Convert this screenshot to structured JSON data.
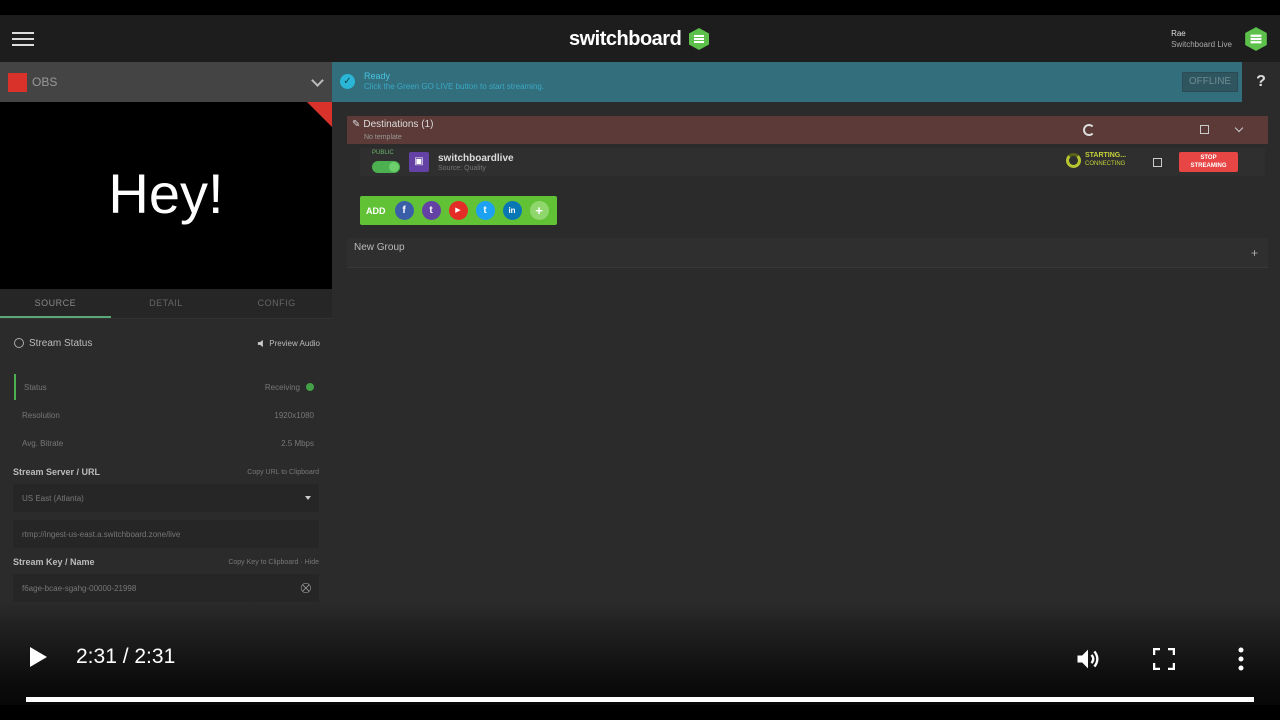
{
  "header": {
    "logo_text": "switchboard",
    "user_name": "Rae",
    "user_org": "Switchboard Live"
  },
  "source": {
    "selected": "OBS",
    "preview_text": "Hey!",
    "tabs": [
      {
        "label": "SOURCE",
        "active": true
      },
      {
        "label": "DETAIL",
        "active": false
      },
      {
        "label": "CONFIG",
        "active": false
      }
    ]
  },
  "stream_status": {
    "title": "Stream Status",
    "preview_audio": "Preview Audio",
    "rows": [
      {
        "label": "Status",
        "value": "Receiving"
      },
      {
        "label": "Resolution",
        "value": "1920x1080"
      },
      {
        "label": "Avg. Bitrate",
        "value": "2.5 Mbps"
      }
    ]
  },
  "stream_server": {
    "label": "Stream Server / URL",
    "hint": "Copy URL to Clipboard",
    "region": "US East (Atlanta)",
    "url": "rtmp://ingest-us-east.a.switchboard.zone/live"
  },
  "stream_key": {
    "label": "Stream Key / Name",
    "hint": "Copy Key to Clipboard · Hide",
    "value": "f6age-bcae-sgahg-00000-21998"
  },
  "ready": {
    "title": "Ready",
    "subtitle": "Click the Green GO LIVE button to start streaming.",
    "offline_label": "OFFLINE",
    "help_label": "?"
  },
  "destinations": {
    "title": "Destinations (1)",
    "subtitle": "No template",
    "row": {
      "visibility": "PUBLIC",
      "name": "switchboardlive",
      "source": "Source: Quality",
      "status": "STARTING...",
      "status_sub": "CONNECTING",
      "stop_label_1": "STOP",
      "stop_label_2": "STREAMING"
    },
    "add_label": "ADD",
    "socials": [
      {
        "icon": "facebook-icon",
        "glyph": "f",
        "color": "#3b5ea8"
      },
      {
        "icon": "twitch-icon",
        "glyph": "t",
        "color": "#6441a5"
      },
      {
        "icon": "youtube-icon",
        "glyph": "▶",
        "color": "#e52d27"
      },
      {
        "icon": "twitter-icon",
        "glyph": "t",
        "color": "#1da1f2"
      },
      {
        "icon": "linkedin-icon",
        "glyph": "in",
        "color": "#0a77b5"
      },
      {
        "icon": "plus-icon",
        "glyph": "+",
        "color": "#8fd66c"
      }
    ],
    "new_group": "New Group"
  },
  "player": {
    "time": "2:31 / 2:31",
    "progress": 1.0
  },
  "colors": {
    "brand_green": "#62c236",
    "ready_bar": "#336e7c",
    "destinations_header": "#5b3a37",
    "stop_red": "#e84545"
  }
}
